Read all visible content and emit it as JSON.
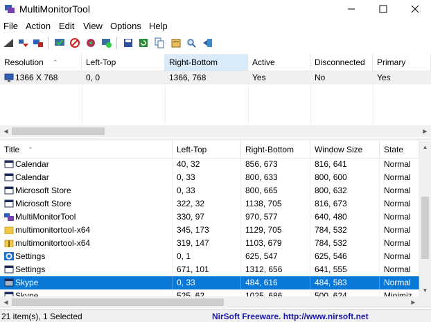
{
  "window": {
    "title": "MultiMonitorTool",
    "minimize": "—",
    "maximize": "☐",
    "close": "✕"
  },
  "menu": [
    "File",
    "Action",
    "Edit",
    "View",
    "Options",
    "Help"
  ],
  "toolbar_icons": [
    "enable-monitor-icon",
    "set-primary-icon",
    "disable-monitor-icon",
    "monitor-check-icon",
    "monitor-disable-icon",
    "monitor-switch-icon",
    "monitor-move-icon",
    "save-icon",
    "refresh-icon",
    "copy-icon",
    "properties-icon",
    "find-icon",
    "exit-icon"
  ],
  "monitors": {
    "columns": [
      "Resolution",
      "Left-Top",
      "Right-Bottom",
      "Active",
      "Disconnected",
      "Primary"
    ],
    "sorted_column": "Right-Bottom",
    "rows": [
      {
        "Resolution": "1366 X 768",
        "Left-Top": "0, 0",
        "Right-Bottom": "1366, 768",
        "Active": "Yes",
        "Disconnected": "No",
        "Primary": "Yes"
      }
    ]
  },
  "windows": {
    "columns": [
      "Title",
      "Left-Top",
      "Right-Bottom",
      "Window Size",
      "State"
    ],
    "rows": [
      {
        "icon": "window-icon",
        "Title": "Calendar",
        "Left-Top": "40, 32",
        "Right-Bottom": "856, 673",
        "Window Size": "816, 641",
        "State": "Normal"
      },
      {
        "icon": "window-icon",
        "Title": "Calendar",
        "Left-Top": "0, 33",
        "Right-Bottom": "800, 633",
        "Window Size": "800, 600",
        "State": "Normal"
      },
      {
        "icon": "window-icon",
        "Title": "Microsoft Store",
        "Left-Top": "0, 33",
        "Right-Bottom": "800, 665",
        "Window Size": "800, 632",
        "State": "Normal"
      },
      {
        "icon": "window-icon",
        "Title": "Microsoft Store",
        "Left-Top": "322, 32",
        "Right-Bottom": "1138, 705",
        "Window Size": "816, 673",
        "State": "Normal"
      },
      {
        "icon": "multimonitortool-icon",
        "Title": "MultiMonitorTool",
        "Left-Top": "330, 97",
        "Right-Bottom": "970, 577",
        "Window Size": "640, 480",
        "State": "Normal"
      },
      {
        "icon": "folder-icon",
        "Title": "multimonitortool-x64",
        "Left-Top": "345, 173",
        "Right-Bottom": "1129, 705",
        "Window Size": "784, 532",
        "State": "Normal"
      },
      {
        "icon": "zip-folder-icon",
        "Title": "multimonitortool-x64",
        "Left-Top": "319, 147",
        "Right-Bottom": "1103, 679",
        "Window Size": "784, 532",
        "State": "Normal"
      },
      {
        "icon": "settings-gear-icon",
        "Title": "Settings",
        "Left-Top": "0, 1",
        "Right-Bottom": "625, 547",
        "Window Size": "625, 546",
        "State": "Normal"
      },
      {
        "icon": "window-icon",
        "Title": "Settings",
        "Left-Top": "671, 101",
        "Right-Bottom": "1312, 656",
        "Window Size": "641, 555",
        "State": "Normal"
      },
      {
        "icon": "skype-window-icon",
        "Title": "Skype",
        "Left-Top": "0, 33",
        "Right-Bottom": "484, 616",
        "Window Size": "484, 583",
        "State": "Normal",
        "selected": true
      },
      {
        "icon": "window-icon",
        "Title": "Skype",
        "Left-Top": "525, 62",
        "Right-Bottom": "1025, 686",
        "Window Size": "500, 624",
        "State": "Minimiz"
      }
    ]
  },
  "status": {
    "count": "21 item(s), 1 Selected",
    "link": "NirSoft Freeware.  http://www.nirsoft.net"
  },
  "colors": {
    "selection": "#0a78d7",
    "sorted_header": "#d9ebf9",
    "link": "#1a1aa6"
  }
}
